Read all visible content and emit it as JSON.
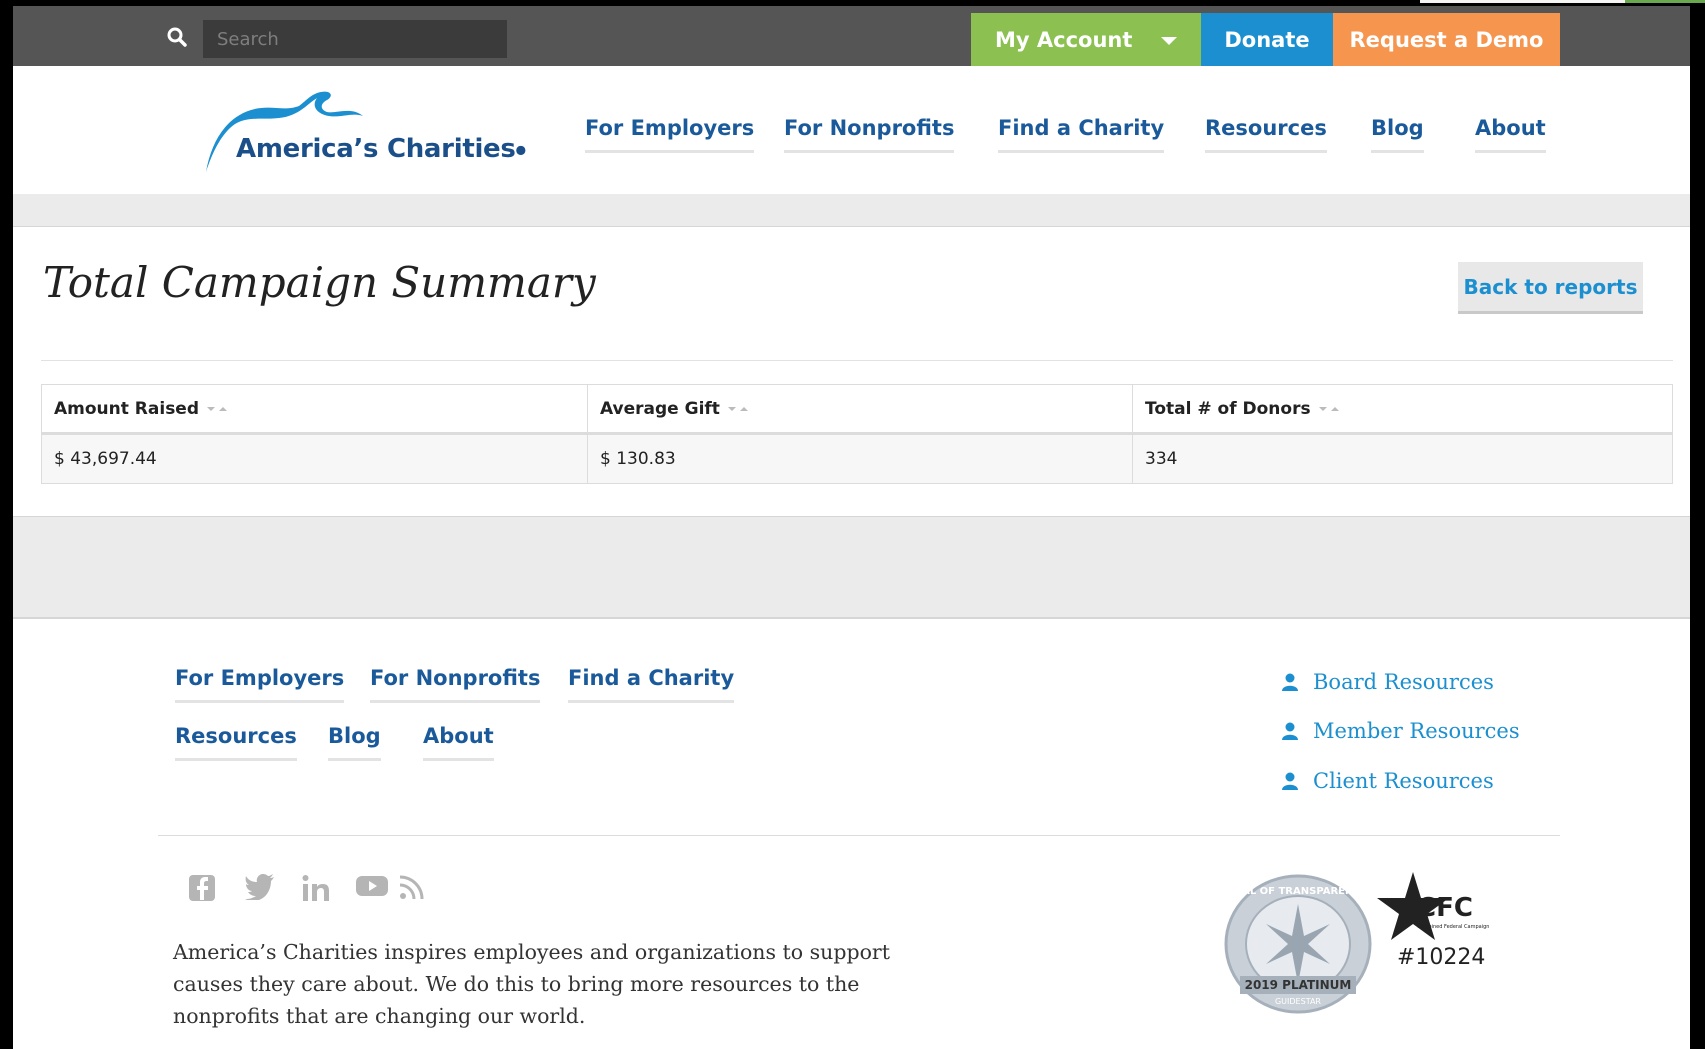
{
  "topbar": {
    "search_placeholder": "Search",
    "my_account_label": "My Account",
    "donate_label": "Donate",
    "request_demo_label": "Request a Demo"
  },
  "header": {
    "logo_text": "America’s Charities",
    "nav": [
      {
        "label": "For Employers"
      },
      {
        "label": "For Nonprofits"
      },
      {
        "label": "Find a Charity"
      },
      {
        "label": "Resources"
      },
      {
        "label": "Blog"
      },
      {
        "label": "About"
      }
    ]
  },
  "main": {
    "title": "Total Campaign Summary",
    "back_label": "Back to reports",
    "table": {
      "columns": [
        "Amount Raised",
        "Average Gift",
        "Total # of Donors"
      ],
      "rows": [
        [
          "$ 43,697.44",
          "$ 130.83",
          "334"
        ]
      ]
    }
  },
  "footer": {
    "links_row1": [
      "For Employers",
      "For Nonprofits",
      "Find a Charity"
    ],
    "links_row2": [
      "Resources",
      "Blog",
      "About"
    ],
    "resources": [
      "Board Resources",
      "Member Resources",
      "Client Resources"
    ],
    "blurb": "America’s Charities inspires employees and organizations to support causes they care about. We do this to bring more resources to the nonprofits that are changing our world.",
    "seal_top": "SEAL OF TRANSPARENCY",
    "seal_year": "2019 PLATINUM",
    "seal_brand": "GUIDESTAR",
    "cfc_logo": "CFC",
    "cfc_tag": "Combined Federal Campaign",
    "cfc_number": "#10224"
  },
  "colors": {
    "account_green": "#8cc152",
    "donate_blue": "#1b8fcf",
    "demo_orange": "#f5954e",
    "nav_blue": "#1b5a9a"
  }
}
